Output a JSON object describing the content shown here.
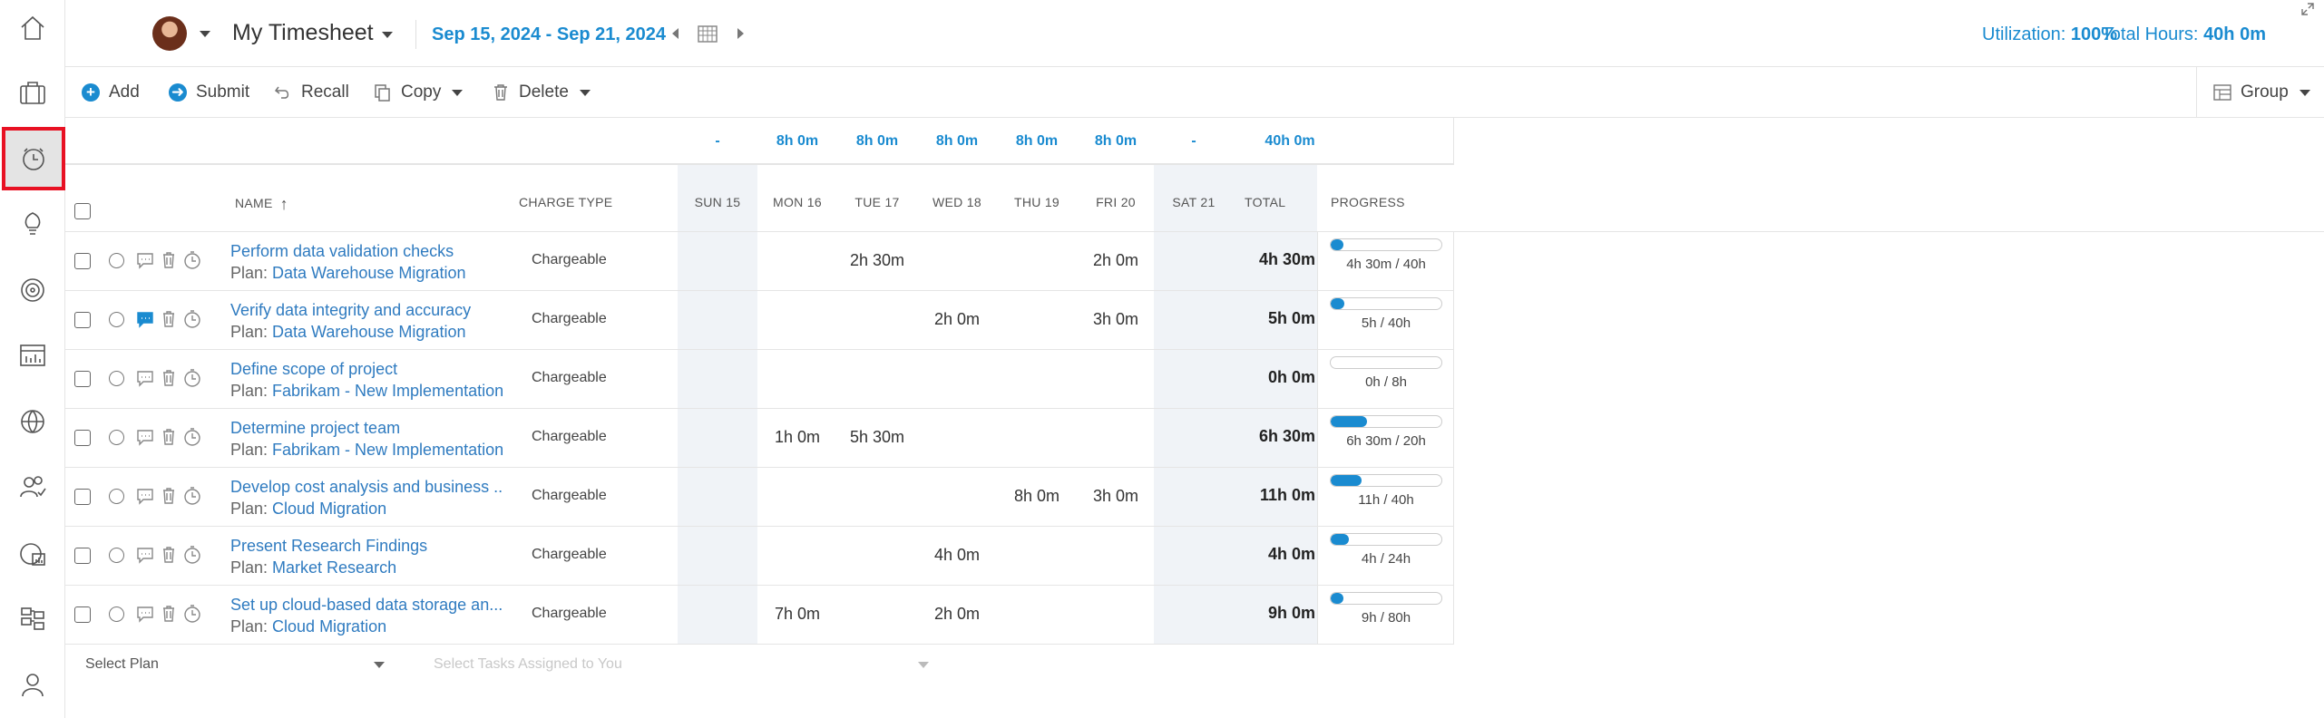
{
  "header": {
    "title": "My Timesheet",
    "date_range": "Sep 15, 2024 - Sep 21, 2024",
    "utilization_label": "Utilization:",
    "utilization_value": "100%",
    "total_hours_label": "Total Hours:",
    "total_hours_value": "40h 0m"
  },
  "sidebar": {
    "items": [
      {
        "icon": "home-icon"
      },
      {
        "icon": "briefcase-icon"
      },
      {
        "icon": "timesheet-clock-icon",
        "active": true
      },
      {
        "icon": "lightbulb-icon"
      },
      {
        "icon": "target-icon"
      },
      {
        "icon": "chart-icon"
      },
      {
        "icon": "globe-icon"
      },
      {
        "icon": "people-check-icon"
      },
      {
        "icon": "report-icon"
      },
      {
        "icon": "hierarchy-icon"
      },
      {
        "icon": "user-icon"
      }
    ]
  },
  "toolbar": {
    "add": "Add",
    "submit": "Submit",
    "recall": "Recall",
    "copy": "Copy",
    "delete": "Delete",
    "group": "Group"
  },
  "summary": {
    "sun": "-",
    "mon": "8h 0m",
    "tue": "8h 0m",
    "wed": "8h 0m",
    "thu": "8h 0m",
    "fri": "8h 0m",
    "sat": "-",
    "total": "40h 0m"
  },
  "columns": {
    "name": "NAME",
    "charge_type": "CHARGE TYPE",
    "sun": "SUN 15",
    "mon": "MON 16",
    "tue": "TUE 17",
    "wed": "WED 18",
    "thu": "THU 19",
    "fri": "FRI 20",
    "sat": "SAT 21",
    "total": "TOTAL",
    "progress": "PROGRESS"
  },
  "plan_prefix": "Plan: ",
  "rows": [
    {
      "name": "Perform data validation checks",
      "plan": "Data Warehouse Migration",
      "charge": "Chargeable",
      "sun": "",
      "mon": "",
      "tue": "2h 30m",
      "wed": "",
      "thu": "",
      "fri": "2h 0m",
      "sat": "",
      "total": "4h 30m",
      "progress": 0.1125,
      "progress_text": "4h 30m / 40h",
      "has_comment": false
    },
    {
      "name": "Verify data integrity and accuracy",
      "plan": "Data Warehouse Migration",
      "charge": "Chargeable",
      "sun": "",
      "mon": "",
      "tue": "",
      "wed": "2h 0m",
      "thu": "",
      "fri": "3h 0m",
      "sat": "",
      "total": "5h 0m",
      "progress": 0.125,
      "progress_text": "5h / 40h",
      "has_comment": true
    },
    {
      "name": "Define scope of project",
      "plan": "Fabrikam - New Implementation",
      "charge": "Chargeable",
      "sun": "",
      "mon": "",
      "tue": "",
      "wed": "",
      "thu": "",
      "fri": "",
      "sat": "",
      "total": "0h 0m",
      "progress": 0,
      "progress_text": "0h / 8h",
      "has_comment": false
    },
    {
      "name": "Determine project team",
      "plan": "Fabrikam - New Implementation",
      "charge": "Chargeable",
      "sun": "",
      "mon": "1h 0m",
      "tue": "5h 30m",
      "wed": "",
      "thu": "",
      "fri": "",
      "sat": "",
      "total": "6h 30m",
      "progress": 0.325,
      "progress_text": "6h 30m / 20h",
      "has_comment": false
    },
    {
      "name": "Develop cost analysis and business ...",
      "plan": "Cloud Migration",
      "charge": "Chargeable",
      "sun": "",
      "mon": "",
      "tue": "",
      "wed": "",
      "thu": "8h 0m",
      "fri": "3h 0m",
      "sat": "",
      "total": "11h 0m",
      "progress": 0.275,
      "progress_text": "11h / 40h",
      "has_comment": false
    },
    {
      "name": "Present Research Findings",
      "plan": "Market Research",
      "charge": "Chargeable",
      "sun": "",
      "mon": "",
      "tue": "",
      "wed": "4h 0m",
      "thu": "",
      "fri": "",
      "sat": "",
      "total": "4h 0m",
      "progress": 0.1667,
      "progress_text": "4h / 24h",
      "has_comment": false
    },
    {
      "name": "Set up cloud-based data storage an...",
      "plan": "Cloud Migration",
      "charge": "Chargeable",
      "sun": "",
      "mon": "7h 0m",
      "tue": "",
      "wed": "2h 0m",
      "thu": "",
      "fri": "",
      "sat": "",
      "total": "9h 0m",
      "progress": 0.1125,
      "progress_text": "9h / 80h",
      "has_comment": false
    }
  ],
  "footer": {
    "select_plan": "Select Plan",
    "select_tasks": "Select Tasks Assigned to You"
  },
  "colors": {
    "accent": "#1a8bd0",
    "link": "#2f7bc0",
    "active_outline": "#e81123",
    "weekend_shade": "#f0f3f7"
  }
}
